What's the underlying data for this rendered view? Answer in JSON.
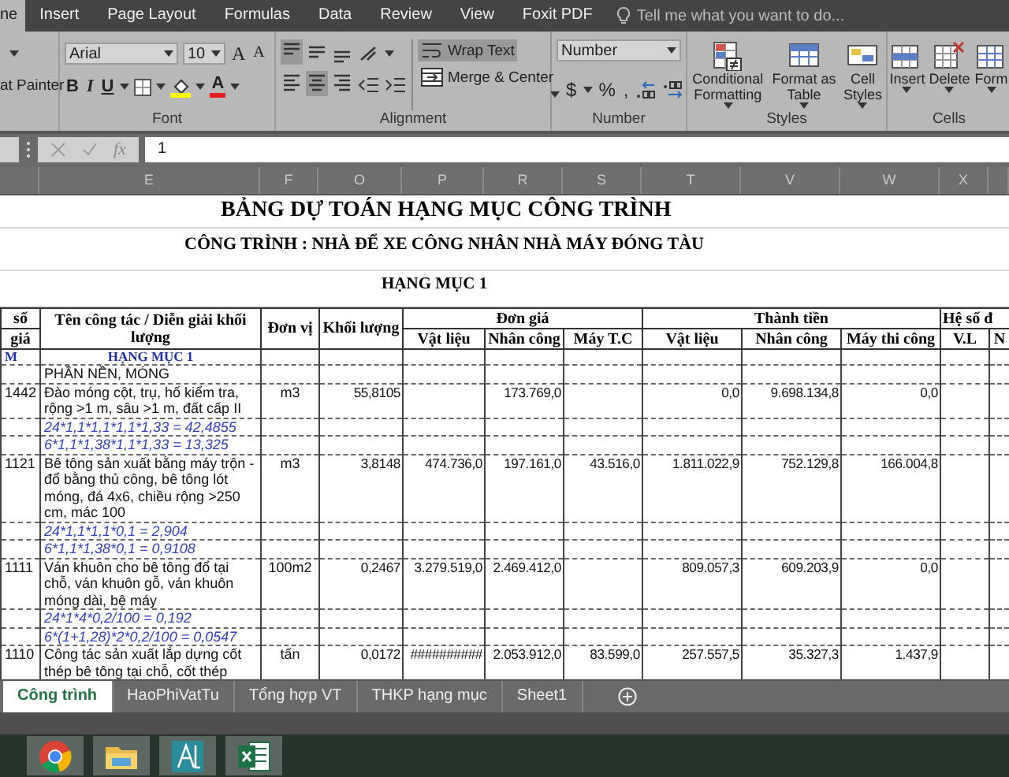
{
  "ribbon_tabs": [
    {
      "label": "ne",
      "selected": true
    },
    {
      "label": "Insert",
      "selected": false
    },
    {
      "label": "Page Layout",
      "selected": false
    },
    {
      "label": "Formulas",
      "selected": false
    },
    {
      "label": "Data",
      "selected": false
    },
    {
      "label": "Review",
      "selected": false
    },
    {
      "label": "View",
      "selected": false
    },
    {
      "label": "Foxit PDF",
      "selected": false
    }
  ],
  "tell_me": {
    "placeholder": "Tell me what you want to do..."
  },
  "ribbon": {
    "clipboard": {
      "format_painter": "at Painter"
    },
    "font": {
      "label": "Font",
      "font_name": "Arial",
      "font_size": "10",
      "grow": "A",
      "shrink": "A",
      "bold": "B",
      "italic": "I",
      "underline": "U",
      "font_color": "A"
    },
    "alignment": {
      "label": "Alignment",
      "align_buttons": [
        {
          "kind": "top",
          "on": true
        },
        {
          "kind": "middle",
          "on": false
        },
        {
          "kind": "bottom",
          "on": false
        },
        {
          "kind": "left",
          "on": false
        },
        {
          "kind": "center",
          "on": true
        },
        {
          "kind": "right",
          "on": false
        }
      ],
      "wrap_text": {
        "label": "Wrap Text",
        "on": true
      },
      "merge_center": "Merge & Center"
    },
    "number": {
      "label": "Number",
      "format": "Number",
      "currency": "$",
      "percent": "%",
      "comma": ","
    },
    "styles": {
      "label": "Styles",
      "buttons": [
        {
          "kind": "conditional",
          "label": "Conditional Formatting"
        },
        {
          "kind": "table",
          "label": "Format as Table"
        },
        {
          "kind": "cellstyles",
          "label": "Cell Styles"
        }
      ]
    },
    "cells": {
      "label": "Cells",
      "buttons": [
        {
          "kind": "insert",
          "label": "Insert"
        },
        {
          "kind": "delete",
          "label": "Delete"
        },
        {
          "kind": "format",
          "label": "Form"
        }
      ]
    }
  },
  "formula_bar": {
    "fx": "fx",
    "value": "1"
  },
  "column_headers": [
    "E",
    "F",
    "O",
    "P",
    "R",
    "S",
    "T",
    "V",
    "W",
    "X"
  ],
  "sheet": {
    "title": "BẢNG DỰ TOÁN HẠNG MỤC CÔNG TRÌNH",
    "subtitle": "CÔNG TRÌNH : NHÀ ĐỂ XE CÔNG NHÂN NHÀ MÁY ĐÓNG TÀU",
    "section_title": "HẠNG MỤC 1",
    "header": {
      "code_top": "số",
      "code_bottom": "giá",
      "name": "Tên công tác / Diễn giải khối lượng",
      "unit": "Đơn vị",
      "qty": "Khối lượng",
      "unit_price": {
        "label": "Đơn giá",
        "subs": [
          "Vật liệu",
          "Nhân công",
          "Máy T.C"
        ]
      },
      "amount": {
        "label": "Thành tiền",
        "subs": [
          "Vật liệu",
          "Nhân công",
          "Máy thi công"
        ]
      },
      "coef": {
        "label": "Hệ số đ",
        "subs": [
          "V.L",
          "N"
        ]
      }
    },
    "rows": [
      {
        "kind": "section",
        "code": "M",
        "name": "HẠNG MỤC 1"
      },
      {
        "kind": "group",
        "name": "PHẦN NỀN, MÓNG"
      },
      {
        "kind": "work",
        "code": "1442",
        "name": "Đào móng cột, trụ, hố kiểm tra, rộng >1 m, sâu >1 m, đất cấp II",
        "unit": "m3",
        "qty": "55,8105",
        "values": {
          "labor_price": "173.769,0",
          "material_amount": "0,0",
          "labor_amount": "9.698.134,8",
          "machine_amount": "0,0"
        }
      },
      {
        "kind": "formula",
        "name": "24*1,1*1,1*1,1*1,33 = 42,4855"
      },
      {
        "kind": "formula",
        "name": "6*1,1*1,38*1,1*1,33 = 13,325"
      },
      {
        "kind": "work",
        "code": "1121",
        "name": "Bê tông sản xuất bằng máy trộn - đổ bằng thủ công, bê tông lót móng, đá 4x6, chiều rộng >250 cm, mác 100",
        "unit": "m3",
        "qty": "3,8148",
        "values": {
          "material_price": "474.736,0",
          "labor_price": "197.161,0",
          "machine_price": "43.516,0",
          "material_amount": "1.811.022,9",
          "labor_amount": "752.129,8",
          "machine_amount": "166.004,8"
        }
      },
      {
        "kind": "formula",
        "name": "24*1,1*1,1*0,1 = 2,904"
      },
      {
        "kind": "formula",
        "name": "6*1,1*1,38*0,1 = 0,9108"
      },
      {
        "kind": "work",
        "code": "1111",
        "name": "Ván khuôn cho bê tông đổ tại chỗ, ván khuôn gỗ, ván khuôn móng dài, bệ máy",
        "unit": "100m2",
        "qty": "0,2467",
        "values": {
          "material_price": "3.279.519,0",
          "labor_price": "2.469.412,0",
          "material_amount": "809.057,3",
          "labor_amount": "609.203,9",
          "machine_amount": "0,0"
        }
      },
      {
        "kind": "formula",
        "name": "24*1*4*0,2/100 = 0,192"
      },
      {
        "kind": "formula",
        "name": "6*(1+1,28)*2*0,2/100 = 0,0547"
      },
      {
        "kind": "work",
        "code": "1110",
        "name": "Công tác sản xuất lắp dựng cốt thép bê tông tại chỗ, cốt thép",
        "unit": "tấn",
        "qty": "0,0172",
        "values": {
          "material_price": "##########",
          "labor_price": "2.053.912,0",
          "machine_price": "83.599,0",
          "material_amount": "257.557,5",
          "labor_amount": "35.327,3",
          "machine_amount": "1.437,9"
        }
      }
    ]
  },
  "sheet_tabs": [
    {
      "label": "Công trình",
      "selected": true
    },
    {
      "label": "HaoPhiVatTu",
      "selected": false
    },
    {
      "label": "Tổng hợp VT",
      "selected": false
    },
    {
      "label": "THKP hạng mục",
      "selected": false
    },
    {
      "label": "Sheet1",
      "selected": false
    }
  ],
  "taskbar": [
    {
      "kind": "browser"
    },
    {
      "kind": "folder"
    },
    {
      "kind": "drafting"
    },
    {
      "kind": "excel"
    }
  ]
}
